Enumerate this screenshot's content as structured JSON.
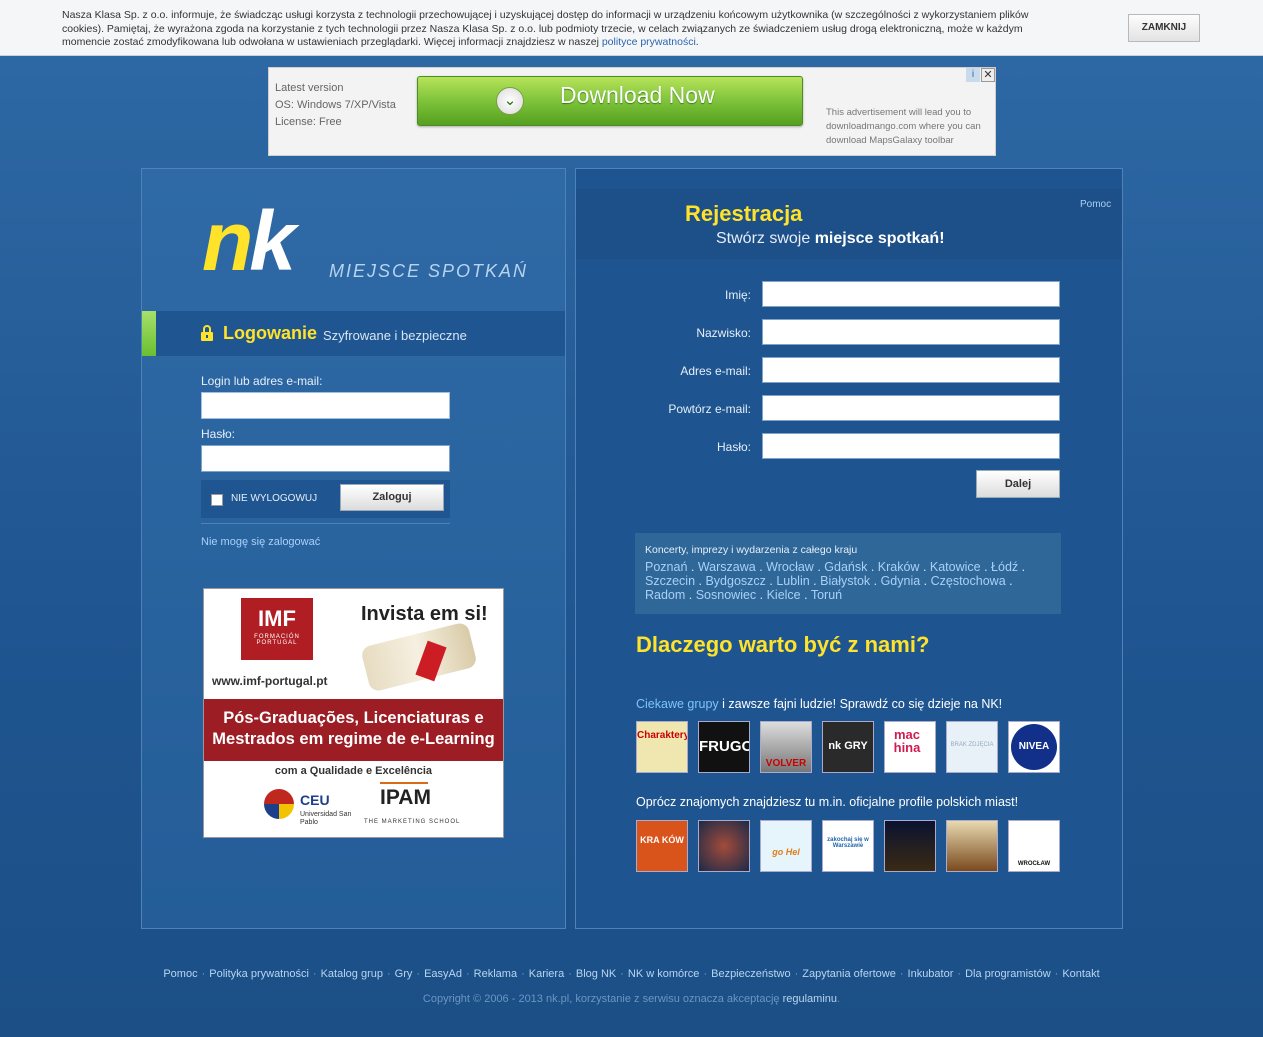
{
  "cookie": {
    "text": "Nasza Klasa Sp. z o.o. informuje, że świadcząc usługi korzysta z technologii przechowującej i uzyskującej dostęp do informacji w urządzeniu końcowym użytkownika (w szczególności z wykorzystaniem plików cookies). Pamiętaj, że wyrażona zgoda na korzystanie z tych technologii przez Nasza Klasa Sp. z o.o. lub podmioty trzecie, w celach związanych ze świadczeniem usług drogą elektroniczną, może w każdym momencie zostać zmodyfikowana lub odwołana w ustawieniach przeglądarki. Więcej informacji znajdziesz w naszej ",
    "link": "polityce prywatności",
    "close": "ZAMKNIJ"
  },
  "ad": {
    "line1": "Latest version",
    "line2": "OS: Windows 7/XP/Vista",
    "line3": "License: Free",
    "button": "Download Now",
    "note": "This advertisement will lead you to downloadmango.com where you can download MapsGalaxy toolbar",
    "info_icon": "i",
    "close_icon": "✕"
  },
  "logo": {
    "n1": "n",
    "n2": "k",
    "tagline": "MIEJSCE SPOTKAŃ"
  },
  "login": {
    "title": "Logowanie",
    "subtitle": "Szyfrowane i bezpieczne",
    "login_label": "Login lub adres e-mail:",
    "password_label": "Hasło:",
    "remember": "NIE WYLOGOWUJ",
    "submit": "Zaloguj",
    "forgot": "Nie mogę się zalogować"
  },
  "banner": {
    "brand": "IMF",
    "brand_sub": "FORMACIÓN",
    "brand_country": "PORTUGAL",
    "url": "www.imf-portugal.pt",
    "headline": "Invista em si!",
    "red_text": "Pós-Graduações, Licenciaturas e Mestrados em regime de e-Learning",
    "quality": "com a Qualidade e Excelência",
    "ceu": "CEU",
    "ceu_sub": "Universidad San Pablo",
    "ipam": "IPAM",
    "ipam_sub": "THE MARKETING SCHOOL"
  },
  "register": {
    "title": "Rejestracja",
    "subtitle_plain": "Stwórz swoje ",
    "subtitle_bold": "miejsce spotkań!",
    "help": "Pomoc",
    "fields": [
      "Imię:",
      "Nazwisko:",
      "Adres e-mail:",
      "Powtórz e-mail:",
      "Hasło:"
    ],
    "next": "Dalej"
  },
  "cities": {
    "header": "Koncerty, imprezy i wydarzenia z całego kraju",
    "list": [
      "Poznań",
      "Warszawa",
      "Wrocław",
      "Gdańsk",
      "Kraków",
      "Katowice",
      "Łódź",
      "Szczecin",
      "Bydgoszcz",
      "Lublin",
      "Białystok",
      "Gdynia",
      "Częstochowa",
      "Radom",
      "Sosnowiec",
      "Kielce",
      "Toruń"
    ]
  },
  "why": {
    "title": "Dlaczego warto być z nami?",
    "groups_link": "Ciekawe grupy",
    "groups_text": " i zawsze fajni ludzie! Sprawdź co się dzieje na NK!",
    "groups": [
      "Charaktery",
      "FRUGO",
      "VOLVER",
      "nk GRY",
      "machina",
      "BRAK ZDJĘCIA",
      "NIVEA"
    ],
    "cities_text": "Oprócz znajomych znajdziesz tu m.in. oficjalne profile polskich miast!",
    "city_profiles": [
      "KRA KÓW",
      "",
      "go Hel",
      "zakochaj się w Warszawie",
      "",
      "",
      "WROCŁAW"
    ]
  },
  "footer": {
    "links": [
      "Pomoc",
      "Polityka prywatności",
      "Katalog grup",
      "Gry",
      "EasyAd",
      "Reklama",
      "Kariera",
      "Blog NK",
      "NK w komórce",
      "Bezpieczeństwo",
      "Zapytania ofertowe",
      "Inkubator",
      "Dla programistów",
      "Kontakt"
    ],
    "copyright": "Copyright © 2006 - 2013 nk.pl, korzystanie z serwisu oznacza akceptację ",
    "terms": "regulaminu"
  }
}
